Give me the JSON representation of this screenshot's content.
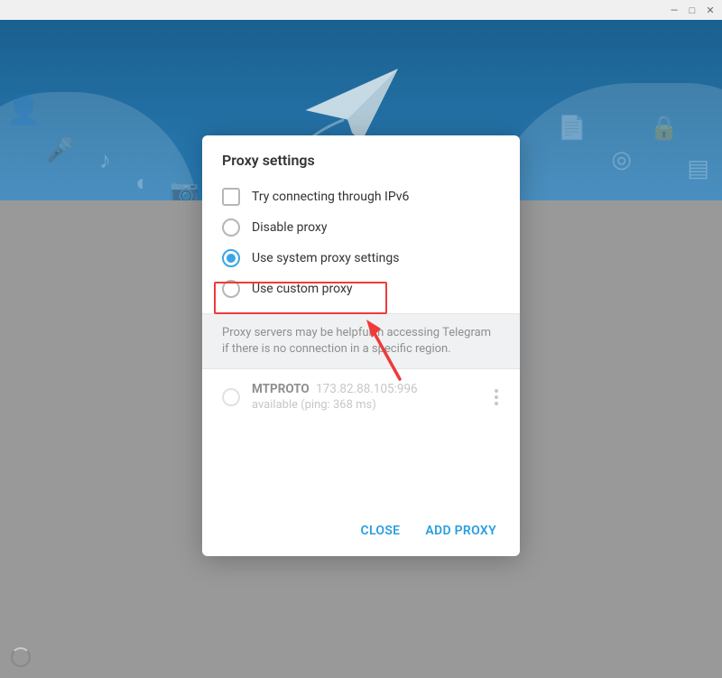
{
  "window": {
    "minimize_glyph": "—",
    "maximize_glyph": "□",
    "close_glyph": "✕"
  },
  "modal": {
    "title": "Proxy settings",
    "options": {
      "ipv6_label": "Try connecting through IPv6",
      "disable_label": "Disable proxy",
      "system_label": "Use system proxy settings",
      "custom_label": "Use custom proxy",
      "selected": "system"
    },
    "info_text": "Proxy servers may be helpful in accessing Telegram if there is no connection in a specific region.",
    "proxy": {
      "protocol": "MTPROTO",
      "address": "173.82.88.105:996",
      "status": "available (ping: 368 ms)"
    },
    "actions": {
      "close": "CLOSE",
      "add": "ADD PROXY"
    }
  },
  "colors": {
    "accent": "#39a5e8",
    "annotation": "#ef3a3a"
  }
}
